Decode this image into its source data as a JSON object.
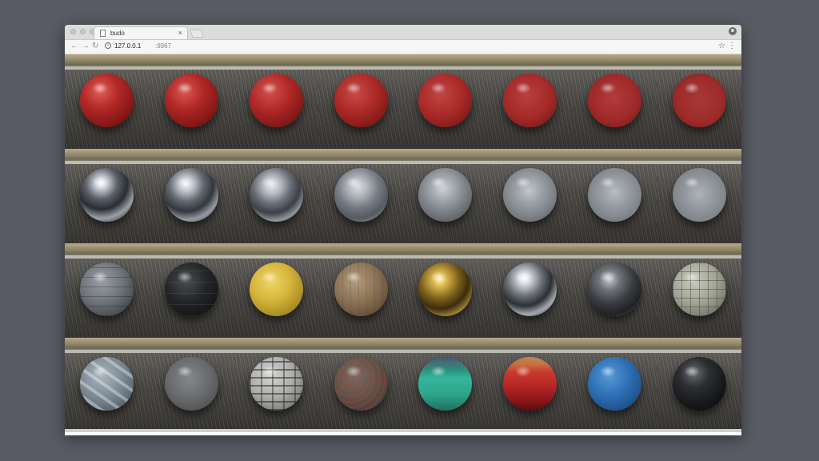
{
  "browser": {
    "tab_title": "budo",
    "tab_close": "×",
    "url_host": "127.0.0.1",
    "url_port": ":9967",
    "back_icon": "←",
    "forward_icon": "→",
    "reload_icon": "↻",
    "star_icon": "☆",
    "menu_icon": "⋮",
    "info_icon": "i"
  },
  "material_grid": {
    "columns": 8,
    "rows": 4,
    "materials": [
      {
        "name": "red-gloss-1",
        "style": "radial-gradient(circle at 38% 32%, #e0605a 0%, #b42a27 35%, #7e1514 75%, #4a0a0a 100%)"
      },
      {
        "name": "red-gloss-2",
        "style": "radial-gradient(circle at 38% 32%, #da5a54 0%, #b02725 38%, #7b1513 78%, #480a0a 100%)"
      },
      {
        "name": "red-gloss-3",
        "style": "radial-gradient(circle at 38% 32%, #d25350 0%, #ad2725 42%, #7a1614 80%, #4a0b0b 100%)"
      },
      {
        "name": "red-gloss-4",
        "style": "radial-gradient(circle at 40% 35%, #c94c4a 0%, #aa2826 45%, #7a1715 82%, #4a0c0c 100%)"
      },
      {
        "name": "red-gloss-5",
        "style": "radial-gradient(circle at 42% 38%, #c14644 0%, #a82a28 48%, #7b1816 84%, #4c0d0d 100%)"
      },
      {
        "name": "red-gloss-6",
        "style": "radial-gradient(circle at 45% 40%, #b8403f 0%, #a42a28 52%, #7c1a18 86%, #4e0f0f 100%)"
      },
      {
        "name": "red-gloss-7",
        "style": "radial-gradient(circle at 48% 45%, #b03c3b 0%, #a02a29 55%, #7d1c1a 88%, #501111 100%)"
      },
      {
        "name": "red-gloss-8",
        "style": "radial-gradient(circle at 50% 48%, #a83837 0%, #9c2b29 58%, #7e1e1c 90%, #521313 100%)"
      },
      {
        "name": "chrome-1",
        "style": "radial-gradient(circle at 40% 28%, #ffffff 0%, #c9cdd4 12%, #5b6068 32%, #2a2d33 52%, #9aa0a8 70%, #3b3e44 88%, #151618 100%)"
      },
      {
        "name": "chrome-2",
        "style": "radial-gradient(circle at 40% 30%, #f4f4f6 0%, #c0c4cb 15%, #646971 35%, #33363c 55%, #959ba3 72%, #40434a 90%, #1a1b1e 100%)"
      },
      {
        "name": "chrome-3",
        "style": "radial-gradient(circle at 42% 32%, #e8e9ec 0%, #b8bcc2 18%, #6d7179 38%, #3d4046 58%, #8f959c 74%, #464950 90%, #202124 100%)"
      },
      {
        "name": "chrome-4",
        "style": "radial-gradient(circle at 44% 35%, #dcdee2 0%, #adb2b8 22%, #767a82 45%, #555960 68%, #7e838a 82%, #3a3d42 100%)"
      },
      {
        "name": "chrome-5",
        "style": "radial-gradient(circle at 46% 38%, #cfd3d8 0%, #a3a8ae 26%, #7d8288 52%, #60646a 76%, #45484d 100%)"
      },
      {
        "name": "chrome-6",
        "style": "radial-gradient(circle at 48% 42%, #c2c7cd 0%, #9da2a8 30%, #81868c 58%, #666a70 82%, #4b4e53 100%)"
      },
      {
        "name": "chrome-7",
        "style": "radial-gradient(circle at 50% 45%, #b8bdc2 0%, #989da3 34%, #83888e 62%, #6b7075 86%, #515459 100%)"
      },
      {
        "name": "chrome-8",
        "style": "radial-gradient(circle at 50% 48%, #aeb3b8 0%, #93989e 38%, #82878c 66%, #6e7277 88%, #56595d 100%)"
      },
      {
        "name": "sci-fi-panel-grey",
        "style": "repeating-linear-gradient(0deg, rgba(0,0,0,0.25) 0px, rgba(0,0,0,0.25) 1px, rgba(0,0,0,0) 1px, rgba(0,0,0,0) 12px), radial-gradient(circle at 40% 35%, #9ba0a6 0%, #6f747a 45%, #3e4246 85%, #222427 100%)"
      },
      {
        "name": "sci-fi-black",
        "style": "repeating-linear-gradient(0deg, rgba(255,255,255,0.08) 0px, rgba(255,255,255,0.08) 1px, rgba(0,0,0,0) 1px, rgba(0,0,0,0) 14px), radial-gradient(circle at 40% 35%, #4a4c50 0%, #232427 45%, #111214 85%, #050506 100%)"
      },
      {
        "name": "yellow-painted-metal",
        "style": "radial-gradient(circle at 40% 35%, #efd56a 0%, #d6b63c 40%, #a88a22 75%, #5e4c10 100%)"
      },
      {
        "name": "wood-panel",
        "style": "repeating-linear-gradient(90deg, rgba(0,0,0,0.1) 0px, rgba(0,0,0,0.1) 1px, rgba(0,0,0,0) 1px, rgba(0,0,0,0) 10px), radial-gradient(circle at 40% 35%, #b39b7d 0%, #8b7254 45%, #5f4b36 82%, #34281c 100%)"
      },
      {
        "name": "gold-metal",
        "style": "radial-gradient(circle at 40% 32%, #fff2b8 0%, #d7b54a 15%, #7a5f1c 40%, #3b2d0d 60%, #a88a3a 78%, #4a3912 100%)"
      },
      {
        "name": "silver-chrome",
        "style": "radial-gradient(circle at 40% 30%, #ffffff 0%, #d6d9de 12%, #6b7078 35%, #2c2f34 55%, #a3a9b0 72%, #3d4046 90%, #18191b 100%)"
      },
      {
        "name": "dark-metal",
        "style": "radial-gradient(circle at 40% 32%, #c4c7cc 0%, #6f7378 22%, #3a3d41 48%, #1f2124 72%, #4d5055 88%, #151618 100%)"
      },
      {
        "name": "stone-tiles",
        "style": "repeating-linear-gradient(0deg, rgba(60,60,50,0.45) 0px, rgba(60,60,50,0.45) 1px, rgba(0,0,0,0) 1px, rgba(0,0,0,0) 11px), repeating-linear-gradient(90deg, rgba(60,60,50,0.45) 0px, rgba(60,60,50,0.45) 1px, rgba(0,0,0,0) 1px, rgba(0,0,0,0) 11px), radial-gradient(circle at 40% 35%, #c7c9bb 0%, #a3a596 45%, #73756a 82%, #45463f 100%)"
      },
      {
        "name": "blue-grey-pattern",
        "style": "repeating-linear-gradient(35deg, rgba(255,255,255,0.35) 0px, rgba(255,255,255,0.35) 4px, rgba(0,0,0,0) 4px, rgba(0,0,0,0) 14px), radial-gradient(circle at 40% 35%, #aab5bd 0%, #7d8a94 45%, #53606a 82%, #2e363c 100%)"
      },
      {
        "name": "matte-grey",
        "style": "radial-gradient(circle at 45% 40%, #858789 0%, #6a6c6e 45%, #4f5153 80%, #343536 100%)"
      },
      {
        "name": "stone-brick",
        "style": "repeating-linear-gradient(0deg, rgba(40,40,40,0.55) 0px, rgba(40,40,40,0.55) 2px, rgba(0,0,0,0) 2px, rgba(0,0,0,0) 10px), repeating-linear-gradient(90deg, rgba(40,40,40,0.45) 0px, rgba(40,40,40,0.45) 2px, rgba(0,0,0,0) 2px, rgba(0,0,0,0) 14px), radial-gradient(circle at 40% 35%, #d4d4d2 0%, #aeaeac 45%, #787876 82%, #464645 100%)"
      },
      {
        "name": "rusted-metal",
        "style": "repeating-radial-gradient(circle at 30% 40%, rgba(150,60,40,0.45) 0px, rgba(150,60,40,0.45) 3px, rgba(60,70,70,0.3) 3px, rgba(60,70,70,0.3) 7px), radial-gradient(circle at 40% 35%, #8a7d74 0%, #6a5a52 45%, #463a35 82%, #231c1a 100%)"
      },
      {
        "name": "teal-striped",
        "style": "linear-gradient(180deg, #3a5a70 0%, #4a6b7a 10%, #2d8a7a 22%, #35b59c 40%, #2ea58c 70%, #1d6f5e 100%)"
      },
      {
        "name": "red-fabric",
        "style": "linear-gradient(180deg, #b58a5a 0%, #c7703f 14%, #c93a2d 28%, #b52526 55%, #8d1719 80%, #5a0d0f 100%)"
      },
      {
        "name": "blue-plastic",
        "style": "radial-gradient(circle at 40% 35%, #5a9ad6 0%, #2f72b8 40%, #1d4f86 78%, #0d2a4a 100%)"
      },
      {
        "name": "black-glossy",
        "style": "radial-gradient(circle at 40% 30%, #6a6d72 0%, #2c2e31 30%, #161719 65%, #080809 100%)"
      }
    ]
  }
}
